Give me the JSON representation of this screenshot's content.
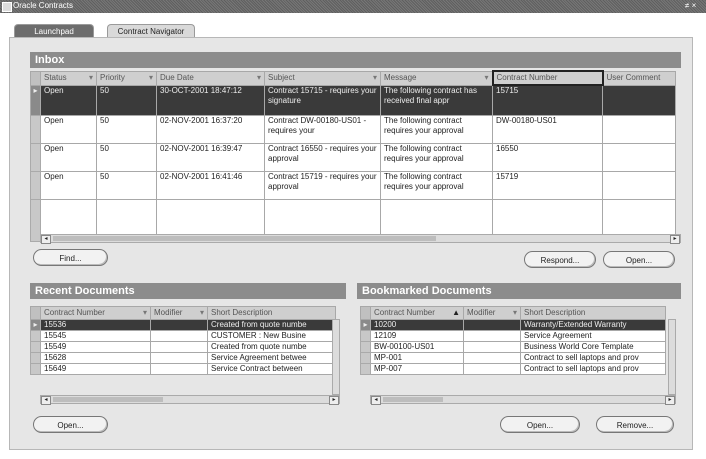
{
  "window": {
    "title": "Oracle Contracts",
    "controls": "≠ ×"
  },
  "tabs": [
    {
      "label": "Launchpad"
    },
    {
      "label": "Contract Navigator"
    }
  ],
  "inbox": {
    "title": "Inbox",
    "columns": [
      "Status",
      "Priority",
      "Due Date",
      "Subject",
      "Message",
      "Contract Number",
      "User Comment"
    ],
    "rows": [
      {
        "status": "Open",
        "priority": "50",
        "due": "30-OCT-2001 18:47:12",
        "subject": "Contract 15715 - requires your signature",
        "message": "The following contract has received final appr",
        "number": "15715",
        "comment": ""
      },
      {
        "status": "Open",
        "priority": "50",
        "due": "02-NOV-2001 16:37:20",
        "subject": "Contract DW-00180-US01 - requires your",
        "message": "The following contract requires your approval",
        "number": "DW-00180-US01",
        "comment": ""
      },
      {
        "status": "Open",
        "priority": "50",
        "due": "02-NOV-2001 16:39:47",
        "subject": "Contract 16550 - requires your approval",
        "message": "The following contract requires your approval",
        "number": "16550",
        "comment": ""
      },
      {
        "status": "Open",
        "priority": "50",
        "due": "02-NOV-2001 16:41:46",
        "subject": "Contract 15719 - requires your approval",
        "message": "The following contract requires your approval",
        "number": "15719",
        "comment": ""
      }
    ],
    "find_label": "Find...",
    "respond_label": "Respond...",
    "open_label": "Open..."
  },
  "recent": {
    "title": "Recent Documents",
    "columns": [
      "Contract Number",
      "Modifier",
      "Short Description"
    ],
    "rows": [
      {
        "number": "15536",
        "modifier": "",
        "desc": "Created from quote numbe"
      },
      {
        "number": "15545",
        "modifier": "",
        "desc": "CUSTOMER : New Busine"
      },
      {
        "number": "15549",
        "modifier": "",
        "desc": "Created from quote numbe"
      },
      {
        "number": "15628",
        "modifier": "",
        "desc": "Service Agreement betwee"
      },
      {
        "number": "15649",
        "modifier": "",
        "desc": "Service Contract between"
      }
    ],
    "open_label": "Open..."
  },
  "bookmarked": {
    "title": "Bookmarked Documents",
    "columns": [
      "Contract Number",
      "Modifier",
      "Short Description"
    ],
    "rows": [
      {
        "number": "10200",
        "modifier": "",
        "desc": "Warranty/Extended Warranty"
      },
      {
        "number": "12109",
        "modifier": "",
        "desc": "Service Agreement"
      },
      {
        "number": "BW-00100-US01",
        "modifier": "",
        "desc": "Business World Core Template"
      },
      {
        "number": "MP-001",
        "modifier": "",
        "desc": "Contract to sell laptops and prov"
      },
      {
        "number": "MP-007",
        "modifier": "",
        "desc": "Contract to sell laptops and prov"
      }
    ],
    "open_label": "Open...",
    "remove_label": "Remove..."
  }
}
